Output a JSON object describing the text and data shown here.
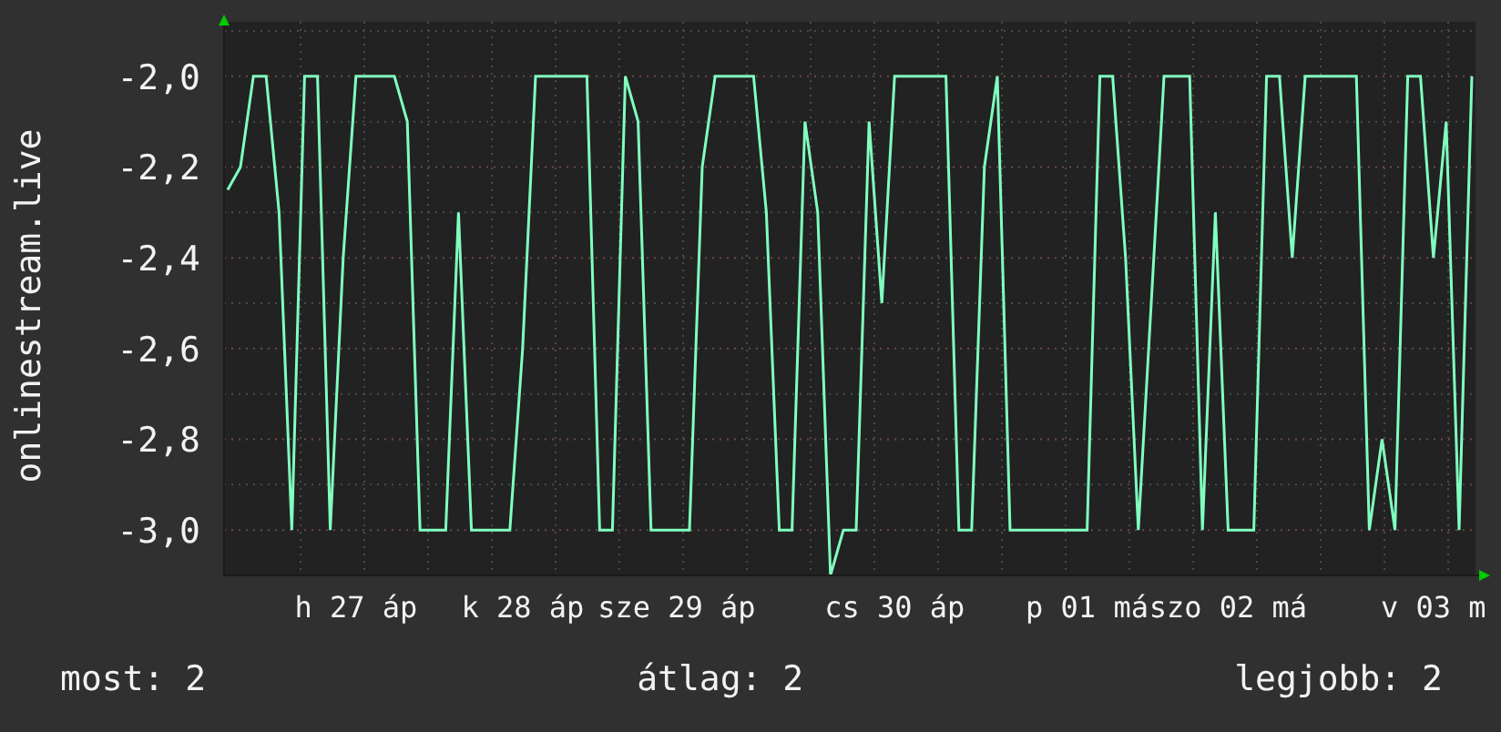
{
  "chart": {
    "chart_data": {
      "type": "line",
      "ylabel": "onlinestream.live",
      "grid": true,
      "categories": [
        null,
        null,
        null,
        null,
        null,
        null,
        null,
        null,
        null,
        null,
        "h 27 áp",
        null,
        null,
        null,
        null,
        null,
        null,
        null,
        null,
        null,
        null,
        null,
        null,
        "k 28 áp",
        null,
        null,
        null,
        null,
        null,
        null,
        null,
        null,
        null,
        null,
        null,
        "sze 29 áp",
        null,
        null,
        null,
        null,
        null,
        null,
        null,
        null,
        null,
        null,
        null,
        null,
        null,
        null,
        null,
        null,
        "cs 30 áp",
        null,
        null,
        null,
        null,
        null,
        null,
        null,
        null,
        null,
        null,
        null,
        null,
        null,
        null,
        "p 01 má",
        null,
        null,
        null,
        null,
        null,
        null,
        null,
        null,
        null,
        null,
        "szo 02 má",
        null,
        null,
        null,
        null,
        null,
        null,
        null,
        null,
        null,
        null,
        null,
        null,
        null,
        null,
        null,
        "v 03 m",
        null,
        null,
        null
      ],
      "ylim": [
        -3.1,
        -1.88
      ],
      "yticks": [
        {
          "value": -2.0,
          "label": "-2,0"
        },
        {
          "value": -2.2,
          "label": "-2,2"
        },
        {
          "value": -2.4,
          "label": "-2,4"
        },
        {
          "value": -2.6,
          "label": "-2,6"
        },
        {
          "value": -2.8,
          "label": "-2,8"
        },
        {
          "value": -3.0,
          "label": "-3,0"
        }
      ],
      "series": [
        {
          "color": "#80ffc0",
          "values": [
            -2.25,
            -2.2,
            -2.0,
            -2.0,
            -2.3,
            -3.0,
            -2.0,
            -2.0,
            -3.0,
            -2.4,
            -2.0,
            -2.0,
            -2.0,
            -2.0,
            -2.1,
            -3.0,
            -3.0,
            -3.0,
            -2.3,
            -3.0,
            -3.0,
            -3.0,
            -3.0,
            -2.6,
            -2.0,
            -2.0,
            -2.0,
            -2.0,
            -2.0,
            -3.0,
            -3.0,
            -2.0,
            -2.1,
            -3.0,
            -3.0,
            -3.0,
            -3.0,
            -2.2,
            -2.0,
            -2.0,
            -2.0,
            -2.0,
            -2.3,
            -3.0,
            -3.0,
            -2.1,
            -2.3,
            -3.1,
            -3.0,
            -3.0,
            -2.1,
            -2.5,
            -2.0,
            -2.0,
            -2.0,
            -2.0,
            -2.0,
            -3.0,
            -3.0,
            -2.2,
            -2.0,
            -3.0,
            -3.0,
            -3.0,
            -3.0,
            -3.0,
            -3.0,
            -3.0,
            -2.0,
            -2.0,
            -2.4,
            -3.0,
            -2.5,
            -2.0,
            -2.0,
            -2.0,
            -3.0,
            -2.3,
            -3.0,
            -3.0,
            -3.0,
            -2.0,
            -2.0,
            -2.4,
            -2.0,
            -2.0,
            -2.0,
            -2.0,
            -2.0,
            -3.0,
            -2.8,
            -3.0,
            -2.0,
            -2.0,
            -2.4,
            -2.1,
            -3.0,
            -2.0
          ]
        }
      ]
    }
  },
  "stats": [
    {
      "text": "most: 2"
    },
    {
      "text": "átlag: 2"
    },
    {
      "text": "legjobb: 2"
    }
  ]
}
